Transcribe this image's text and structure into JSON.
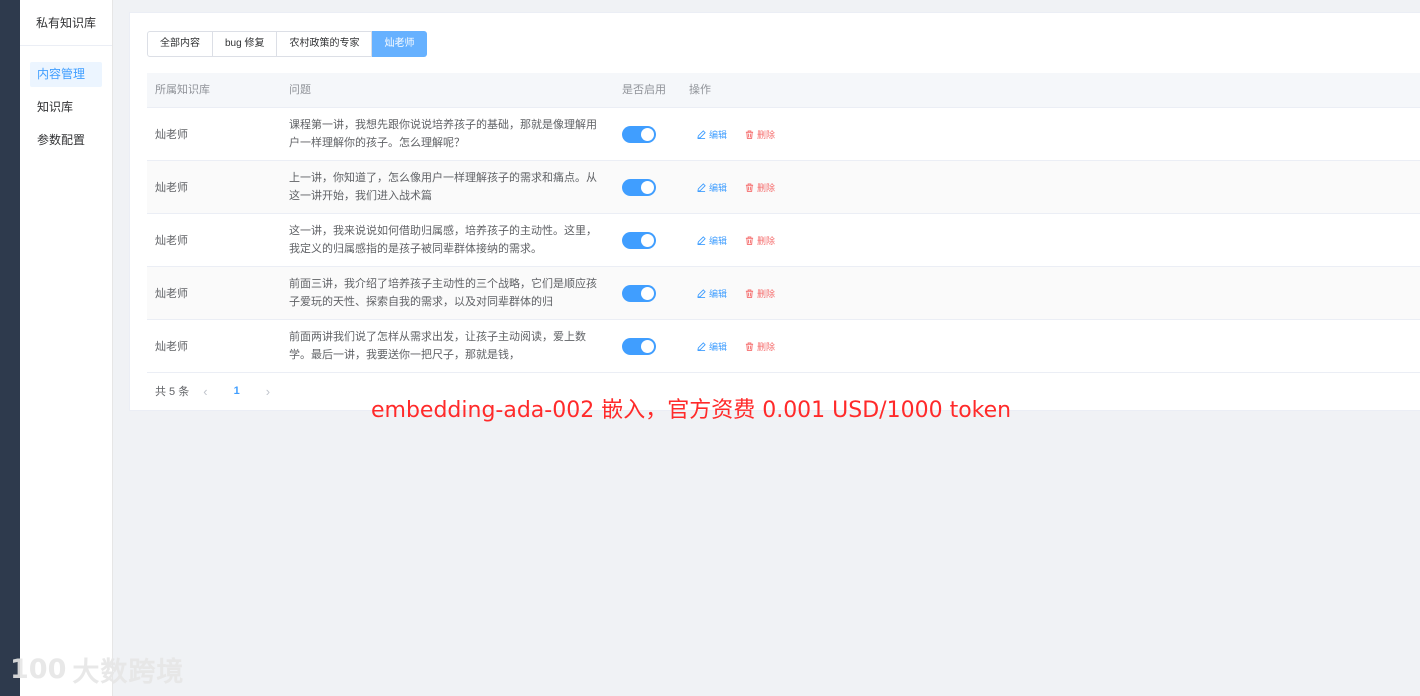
{
  "sidebar": {
    "title": "私有知识库",
    "items": [
      {
        "label": "内容管理",
        "active": true
      },
      {
        "label": "知识库",
        "active": false
      },
      {
        "label": "参数配置",
        "active": false
      }
    ]
  },
  "tabs": [
    {
      "label": "全部内容",
      "active": false
    },
    {
      "label": "bug 修复",
      "active": false
    },
    {
      "label": "农村政策的专家",
      "active": false
    },
    {
      "label": "灿老师",
      "active": true
    }
  ],
  "table": {
    "headers": [
      "所属知识库",
      "问题",
      "是否启用",
      "操作"
    ],
    "rows": [
      {
        "kb": "灿老师",
        "question": "课程第一讲，我想先跟你说说培养孩子的基础，那就是像理解用户一样理解你的孩子。怎么理解呢？",
        "enabled": true
      },
      {
        "kb": "灿老师",
        "question": "上一讲，你知道了，怎么像用户一样理解孩子的需求和痛点。从这一讲开始，我们进入战术篇",
        "enabled": true
      },
      {
        "kb": "灿老师",
        "question": "这一讲，我来说说如何借助归属感，培养孩子的主动性。这里，我定义的归属感指的是孩子被同辈群体接纳的需求。",
        "enabled": true
      },
      {
        "kb": "灿老师",
        "question": "前面三讲，我介绍了培养孩子主动性的三个战略，它们是顺应孩子爱玩的天性、探索自我的需求，以及对同辈群体的归",
        "enabled": true
      },
      {
        "kb": "灿老师",
        "question": "前面两讲我们说了怎样从需求出发，让孩子主动阅读，爱上数学。最后一讲，我要送你一把尺子，那就是钱，",
        "enabled": true
      }
    ],
    "edit_label": "编辑",
    "delete_label": "删除"
  },
  "pagination": {
    "total_label": "共 5 条",
    "current_page": "1",
    "prev": "‹",
    "next": "›"
  },
  "annotation": "embedding-ada-002 嵌入，官方资费 0.001 USD/1000 token",
  "watermark": {
    "logo": "100",
    "text": "大数跨境"
  },
  "colors": {
    "accent": "#409eff",
    "danger": "#f56c6c",
    "annotation": "#ff2a2a",
    "sidebar_dark": "#2e3a4d"
  }
}
